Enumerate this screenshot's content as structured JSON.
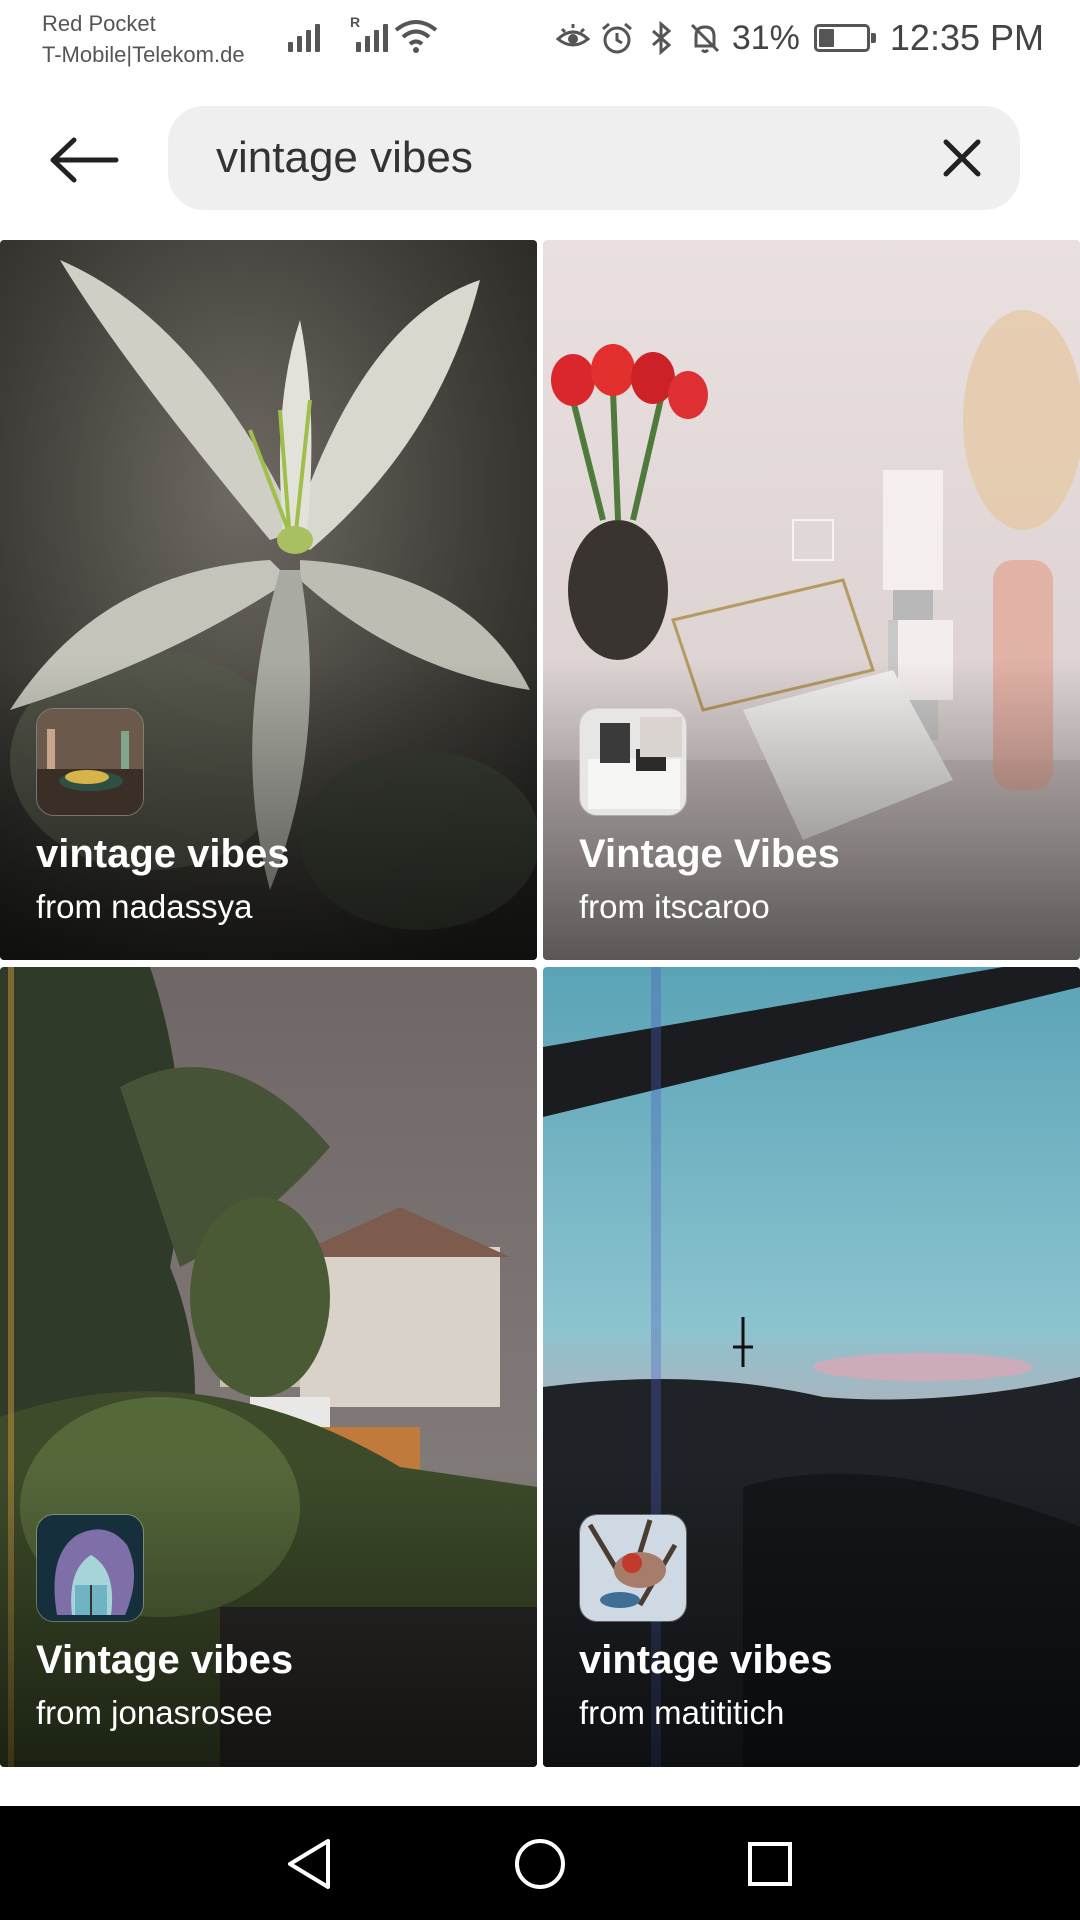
{
  "status_bar": {
    "carrier_line1": "Red Pocket",
    "carrier_line2": "T-Mobile|Telekom.de",
    "roaming_label": "R",
    "battery_percent": "31%",
    "battery_level": 0.31,
    "time": "12:35 PM",
    "icons": [
      "signal-icon",
      "roaming-signal-icon",
      "wifi-icon",
      "eye-comfort-icon",
      "alarm-icon",
      "bluetooth-icon",
      "mute-icon",
      "battery-saver-icon"
    ]
  },
  "search": {
    "query": "vintage vibes",
    "back_icon": "arrow-left-icon",
    "clear_icon": "close-icon"
  },
  "results": [
    {
      "title": "vintage vibes",
      "author": "from nadassya",
      "image": "white lily flower"
    },
    {
      "title": "Vintage Vibes",
      "author": "from itscaroo",
      "image": "tulips and candles on shelf"
    },
    {
      "title": "Vintage vibes",
      "author": "from jonasrosee",
      "image": "garden with trees under cloudy sky"
    },
    {
      "title": "vintage vibes",
      "author": "from matititich",
      "image": "evening sky over hills"
    }
  ],
  "nav_bar": {
    "icons": [
      "back-triangle-icon",
      "home-circle-icon",
      "recents-square-icon"
    ]
  },
  "colors": {
    "search_bg": "#efefef",
    "nav_bg": "#000000",
    "text_white": "#ffffff"
  }
}
